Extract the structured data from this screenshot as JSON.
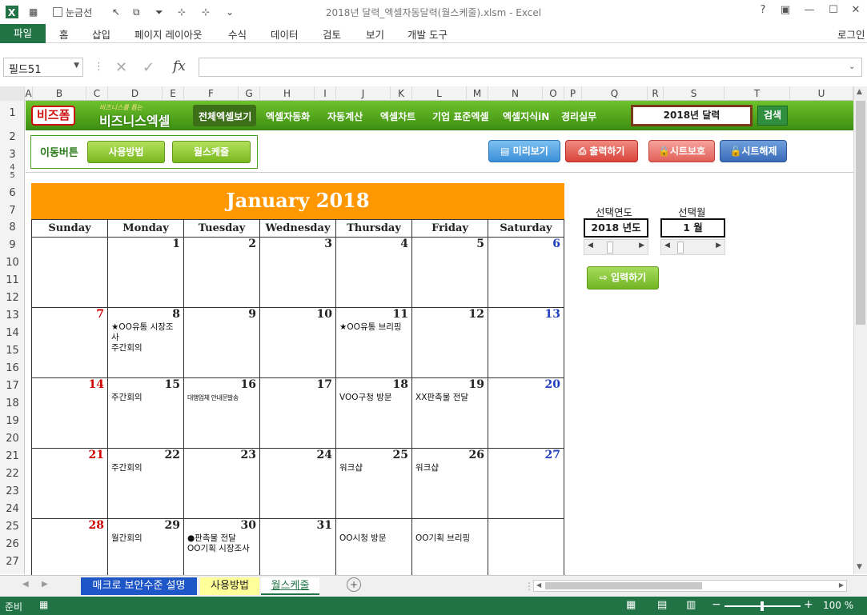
{
  "window": {
    "title": "2018년 달력_엑셀자동달력(월스케줄).xlsm - Excel",
    "qat_gridlines": "눈금선",
    "signin": "로그인"
  },
  "ribbon": {
    "file": "파일",
    "tabs": [
      "홈",
      "삽입",
      "페이지 레이아웃",
      "수식",
      "데이터",
      "검토",
      "보기",
      "개발 도구"
    ]
  },
  "formula": {
    "namebox": "필드51",
    "fx": "fx",
    "value": ""
  },
  "columns": [
    "A",
    "B",
    "C",
    "D",
    "E",
    "F",
    "G",
    "H",
    "I",
    "J",
    "K",
    "L",
    "M",
    "N",
    "O",
    "P",
    "Q",
    "R",
    "S",
    "T",
    "U"
  ],
  "rows": [
    "1",
    "2",
    "3",
    "4",
    "5",
    "6",
    "7",
    "8",
    "9",
    "10",
    "11",
    "12",
    "13",
    "14",
    "15",
    "16",
    "17",
    "18",
    "19",
    "20",
    "21",
    "22",
    "23",
    "24",
    "25",
    "26",
    "27"
  ],
  "header_bar": {
    "logo1": "비즈폼",
    "logo2_small": "비즈니스를 돕는",
    "logo2": "비즈니스엑셀",
    "nav": [
      "전체엑셀보기",
      "엑셀자동화",
      "자동계산",
      "엑셀차트",
      "기업 표준엑셀",
      "엑셀지식iN",
      "경리실무"
    ],
    "search_value": "2018년 달력",
    "search_button": "검색"
  },
  "move": {
    "label": "이동버튼",
    "buttons": [
      "사용방법",
      "월스케줄"
    ]
  },
  "tools": [
    "미리보기",
    "출력하기",
    "시트보호",
    "시트해제"
  ],
  "calendar": {
    "title": "January 2018",
    "weekdays": [
      "Sunday",
      "Monday",
      "Tuesday",
      "Wednesday",
      "Thursday",
      "Friday",
      "Saturday"
    ],
    "weeks": [
      [
        {
          "d": "",
          "e": []
        },
        {
          "d": "1",
          "e": []
        },
        {
          "d": "2",
          "e": []
        },
        {
          "d": "3",
          "e": []
        },
        {
          "d": "4",
          "e": []
        },
        {
          "d": "5",
          "e": []
        },
        {
          "d": "6",
          "e": []
        }
      ],
      [
        {
          "d": "7",
          "e": []
        },
        {
          "d": "8",
          "e": [
            "★OO유통 시장조사",
            "주간회의"
          ]
        },
        {
          "d": "9",
          "e": []
        },
        {
          "d": "10",
          "e": []
        },
        {
          "d": "11",
          "e": [
            "★OO유통 브리핑"
          ]
        },
        {
          "d": "12",
          "e": []
        },
        {
          "d": "13",
          "e": []
        }
      ],
      [
        {
          "d": "14",
          "e": []
        },
        {
          "d": "15",
          "e": [
            "주간회의"
          ]
        },
        {
          "d": "16",
          "e": [
            "대행업체 안내문발송"
          ]
        },
        {
          "d": "17",
          "e": []
        },
        {
          "d": "18",
          "e": [
            "VOO구청 방문"
          ]
        },
        {
          "d": "19",
          "e": [
            "XX판촉물 전달"
          ]
        },
        {
          "d": "20",
          "e": []
        }
      ],
      [
        {
          "d": "21",
          "e": []
        },
        {
          "d": "22",
          "e": [
            "주간회의"
          ]
        },
        {
          "d": "23",
          "e": []
        },
        {
          "d": "24",
          "e": []
        },
        {
          "d": "25",
          "e": [
            "워크샵"
          ]
        },
        {
          "d": "26",
          "e": [
            "워크샵"
          ]
        },
        {
          "d": "27",
          "e": []
        }
      ],
      [
        {
          "d": "28",
          "e": []
        },
        {
          "d": "29",
          "e": [
            "월간회의"
          ]
        },
        {
          "d": "30",
          "e": [
            "●판촉물 전달",
            "OO기획 시장조사"
          ]
        },
        {
          "d": "31",
          "e": []
        },
        {
          "d": "",
          "e": [
            "OO시청 방문"
          ]
        },
        {
          "d": "",
          "e": [
            "OO기획 브리핑"
          ]
        },
        {
          "d": "",
          "e": []
        }
      ]
    ]
  },
  "controls": {
    "year_label": "선택연도",
    "year_value": "2018 년도",
    "month_label": "선택월",
    "month_value": "1 월",
    "input_button": "입력하기"
  },
  "sheets": [
    "매크로 보안수준 설명",
    "사용방법",
    "월스케줄"
  ],
  "status": {
    "ready": "준비",
    "zoom": "100 %"
  },
  "colors": {
    "excel_green": "#217346",
    "calendar_header": "#ff9800",
    "sunday": "#d00000",
    "saturday": "#1f3fbf"
  }
}
